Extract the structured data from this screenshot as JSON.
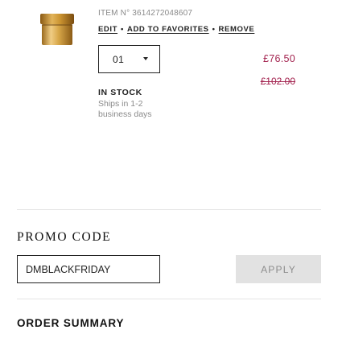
{
  "cart_item": {
    "item_number": "ITEM N° 3614272048607",
    "actions": {
      "edit": "EDIT",
      "add_to_favorites": "ADD TO FAVORITES",
      "remove": "REMOVE",
      "separator": "•"
    },
    "quantity": "01",
    "price_current": "£76.50",
    "price_original": "£102.00",
    "stock_status": "IN STOCK",
    "shipping_note": "Ships in 1-2 business days",
    "image_icon": "product-jar-icon"
  },
  "promo": {
    "title": "PROMO CODE",
    "code_value": "DMBLACKFRIDAY",
    "apply_label": "APPLY"
  },
  "summary": {
    "title": "ORDER SUMMARY"
  },
  "colors": {
    "price": "#a3234f",
    "apply_bg": "#e2e2e2",
    "divider": "#e4e4e4"
  }
}
